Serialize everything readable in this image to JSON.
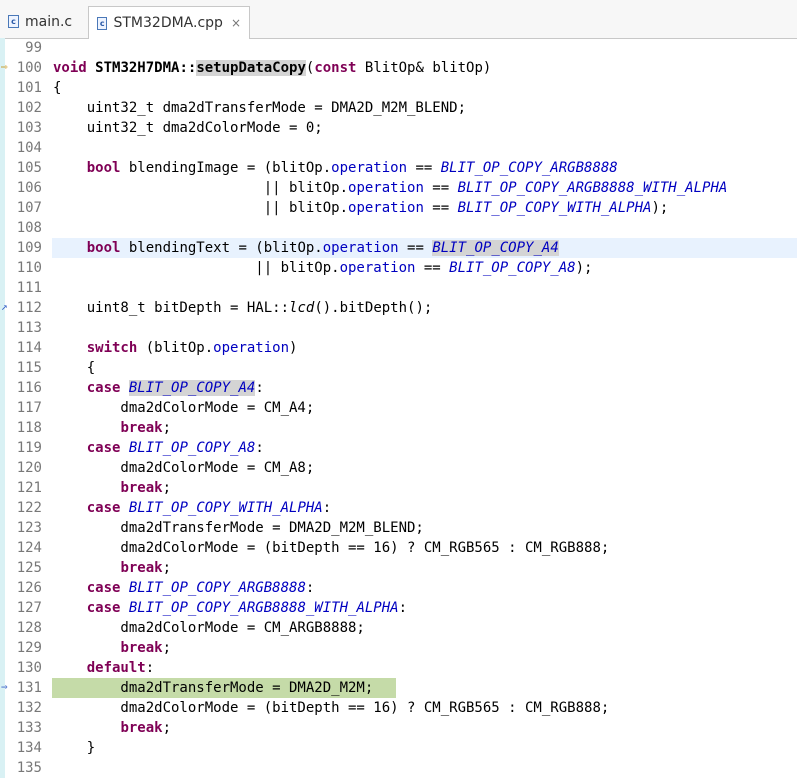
{
  "tabs": [
    {
      "label": "main.c",
      "active": false,
      "icon": "c-file-icon"
    },
    {
      "label": "STM32DMA.cpp",
      "active": true,
      "icon": "cpp-file-icon",
      "close": "×"
    }
  ],
  "editor": {
    "current_line": 109,
    "debug_line": 131,
    "lines": [
      {
        "n": "99",
        "tokens": []
      },
      {
        "n": "100",
        "tokens": [
          [
            "kw",
            "void"
          ],
          [
            "t",
            " "
          ],
          [
            "b",
            "STM32H7DMA::"
          ],
          [
            "occb",
            "setupDataCopy"
          ],
          [
            "t",
            "("
          ],
          [
            "kw",
            "const"
          ],
          [
            "t",
            " BlitOp& blitOp)"
          ]
        ]
      },
      {
        "n": "101",
        "tokens": [
          [
            "t",
            "{"
          ]
        ]
      },
      {
        "n": "102",
        "tokens": [
          [
            "t",
            "    uint32_t dma2dTransferMode = DMA2D_M2M_BLEND;"
          ]
        ]
      },
      {
        "n": "103",
        "tokens": [
          [
            "t",
            "    uint32_t dma2dColorMode = 0;"
          ]
        ]
      },
      {
        "n": "104",
        "tokens": []
      },
      {
        "n": "105",
        "tokens": [
          [
            "t",
            "    "
          ],
          [
            "kw",
            "bool"
          ],
          [
            "t",
            " blendingImage = (blitOp."
          ],
          [
            "field",
            "operation"
          ],
          [
            "t",
            " == "
          ],
          [
            "macro",
            "BLIT_OP_COPY_ARGB8888"
          ]
        ]
      },
      {
        "n": "106",
        "tokens": [
          [
            "t",
            "                         || blitOp."
          ],
          [
            "field",
            "operation"
          ],
          [
            "t",
            " == "
          ],
          [
            "macro",
            "BLIT_OP_COPY_ARGB8888_WITH_ALPHA"
          ]
        ]
      },
      {
        "n": "107",
        "tokens": [
          [
            "t",
            "                         || blitOp."
          ],
          [
            "field",
            "operation"
          ],
          [
            "t",
            " == "
          ],
          [
            "macro",
            "BLIT_OP_COPY_WITH_ALPHA"
          ],
          [
            "t",
            ");"
          ]
        ]
      },
      {
        "n": "108",
        "tokens": []
      },
      {
        "n": "109",
        "tokens": [
          [
            "t",
            "    "
          ],
          [
            "kw",
            "bool"
          ],
          [
            "t",
            " blendingText = (blitOp."
          ],
          [
            "field",
            "operation"
          ],
          [
            "t",
            " == "
          ],
          [
            "occm",
            "BLIT_OP_COPY_A4"
          ]
        ]
      },
      {
        "n": "110",
        "tokens": [
          [
            "t",
            "                        || blitOp."
          ],
          [
            "field",
            "operation"
          ],
          [
            "t",
            " == "
          ],
          [
            "macro",
            "BLIT_OP_COPY_A8"
          ],
          [
            "t",
            ");"
          ]
        ]
      },
      {
        "n": "111",
        "tokens": []
      },
      {
        "n": "112",
        "tokens": [
          [
            "t",
            "    uint8_t bitDepth = HAL::"
          ],
          [
            "fn",
            "lcd"
          ],
          [
            "t",
            "().bitDepth();"
          ]
        ]
      },
      {
        "n": "113",
        "tokens": []
      },
      {
        "n": "114",
        "tokens": [
          [
            "t",
            "    "
          ],
          [
            "kw",
            "switch"
          ],
          [
            "t",
            " (blitOp."
          ],
          [
            "field",
            "operation"
          ],
          [
            "t",
            ")"
          ]
        ]
      },
      {
        "n": "115",
        "tokens": [
          [
            "t",
            "    {"
          ]
        ]
      },
      {
        "n": "116",
        "tokens": [
          [
            "t",
            "    "
          ],
          [
            "kw",
            "case"
          ],
          [
            "t",
            " "
          ],
          [
            "occm",
            "BLIT_OP_COPY_A4"
          ],
          [
            "t",
            ":"
          ]
        ]
      },
      {
        "n": "117",
        "tokens": [
          [
            "t",
            "        dma2dColorMode = CM_A4;"
          ]
        ]
      },
      {
        "n": "118",
        "tokens": [
          [
            "t",
            "        "
          ],
          [
            "kw",
            "break"
          ],
          [
            "t",
            ";"
          ]
        ]
      },
      {
        "n": "119",
        "tokens": [
          [
            "t",
            "    "
          ],
          [
            "kw",
            "case"
          ],
          [
            "t",
            " "
          ],
          [
            "macro",
            "BLIT_OP_COPY_A8"
          ],
          [
            "t",
            ":"
          ]
        ]
      },
      {
        "n": "120",
        "tokens": [
          [
            "t",
            "        dma2dColorMode = CM_A8;"
          ]
        ]
      },
      {
        "n": "121",
        "tokens": [
          [
            "t",
            "        "
          ],
          [
            "kw",
            "break"
          ],
          [
            "t",
            ";"
          ]
        ]
      },
      {
        "n": "122",
        "tokens": [
          [
            "t",
            "    "
          ],
          [
            "kw",
            "case"
          ],
          [
            "t",
            " "
          ],
          [
            "macro",
            "BLIT_OP_COPY_WITH_ALPHA"
          ],
          [
            "t",
            ":"
          ]
        ]
      },
      {
        "n": "123",
        "tokens": [
          [
            "t",
            "        dma2dTransferMode = DMA2D_M2M_BLEND;"
          ]
        ]
      },
      {
        "n": "124",
        "tokens": [
          [
            "t",
            "        dma2dColorMode = (bitDepth == 16) ? CM_RGB565 : CM_RGB888;"
          ]
        ]
      },
      {
        "n": "125",
        "tokens": [
          [
            "t",
            "        "
          ],
          [
            "kw",
            "break"
          ],
          [
            "t",
            ";"
          ]
        ]
      },
      {
        "n": "126",
        "tokens": [
          [
            "t",
            "    "
          ],
          [
            "kw",
            "case"
          ],
          [
            "t",
            " "
          ],
          [
            "macro",
            "BLIT_OP_COPY_ARGB8888"
          ],
          [
            "t",
            ":"
          ]
        ]
      },
      {
        "n": "127",
        "tokens": [
          [
            "t",
            "    "
          ],
          [
            "kw",
            "case"
          ],
          [
            "t",
            " "
          ],
          [
            "macro",
            "BLIT_OP_COPY_ARGB8888_WITH_ALPHA"
          ],
          [
            "t",
            ":"
          ]
        ]
      },
      {
        "n": "128",
        "tokens": [
          [
            "t",
            "        dma2dColorMode = CM_ARGB8888;"
          ]
        ]
      },
      {
        "n": "129",
        "tokens": [
          [
            "t",
            "        "
          ],
          [
            "kw",
            "break"
          ],
          [
            "t",
            ";"
          ]
        ]
      },
      {
        "n": "130",
        "tokens": [
          [
            "t",
            "    "
          ],
          [
            "kw",
            "default"
          ],
          [
            "t",
            ":"
          ]
        ]
      },
      {
        "n": "131",
        "tokens": [
          [
            "t",
            "        dma2dTransferMode = DMA2D_M2M;"
          ]
        ]
      },
      {
        "n": "132",
        "tokens": [
          [
            "t",
            "        dma2dColorMode = (bitDepth == 16) ? CM_RGB565 : CM_RGB888;"
          ]
        ]
      },
      {
        "n": "133",
        "tokens": [
          [
            "t",
            "        "
          ],
          [
            "kw",
            "break"
          ],
          [
            "t",
            ";"
          ]
        ]
      },
      {
        "n": "134",
        "tokens": [
          [
            "t",
            "    }"
          ]
        ]
      },
      {
        "n": "135",
        "tokens": []
      }
    ]
  },
  "colors": {
    "keyword": "#7f0055",
    "field": "#0000c0",
    "current_line_bg": "#e8f2fe",
    "debug_line_bg": "#c5dba8",
    "occurrence_bg": "#d4d4d4",
    "line_number": "#787878"
  }
}
